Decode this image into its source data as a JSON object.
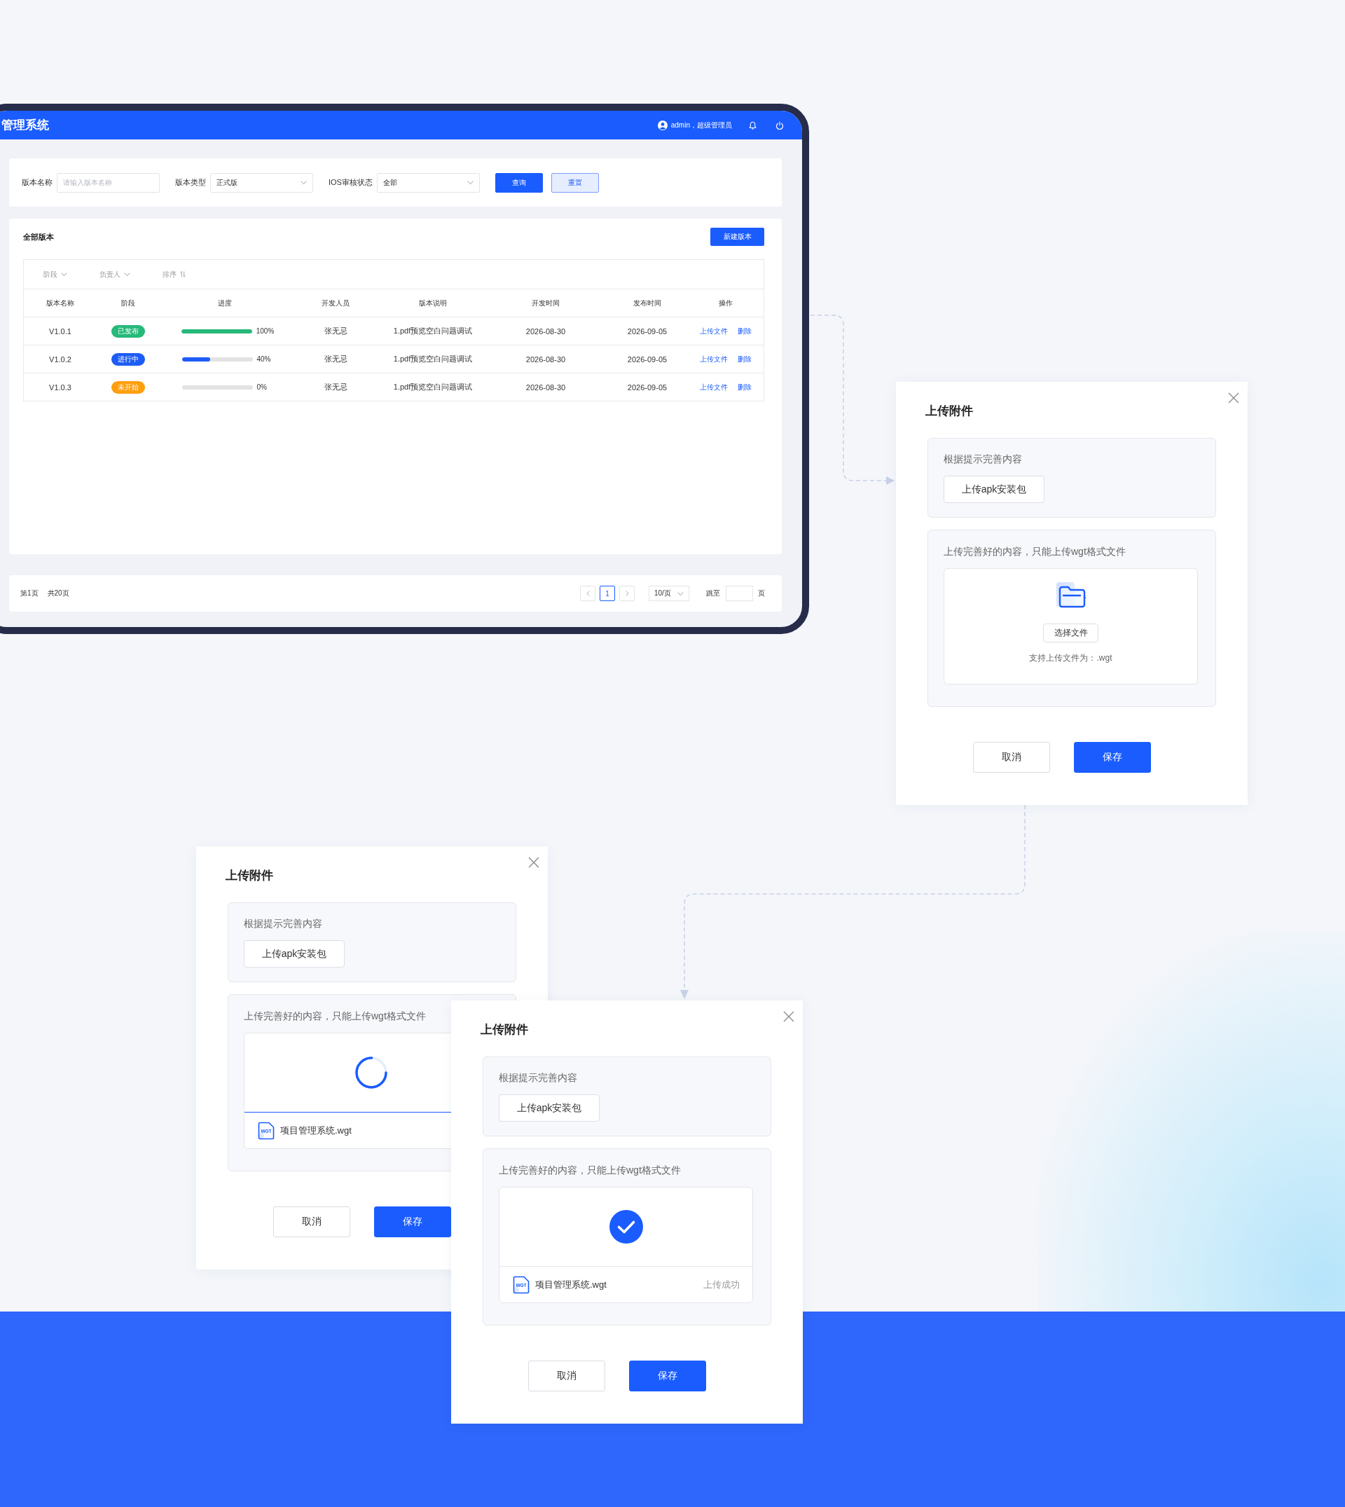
{
  "app": {
    "title": "管理系统",
    "user": "admin，超级管理员",
    "filters": [
      {
        "label": "版本名称",
        "kind": "input",
        "placeholder": "请输入版本名称"
      },
      {
        "label": "版本类型",
        "kind": "select",
        "value": "正式版"
      },
      {
        "label": "IOS审核状态",
        "kind": "select",
        "value": "全部"
      }
    ],
    "filter_buttons": [
      {
        "label": "查询",
        "kind": "primary"
      },
      {
        "label": "重置",
        "kind": "secondary"
      }
    ],
    "list": {
      "title": "全部版本",
      "new_button": "新建版本",
      "toolbar": [
        {
          "label": "阶段",
          "kind": "dropdown"
        },
        {
          "label": "负责人",
          "kind": "dropdown"
        },
        {
          "label": "排序",
          "kind": "sort"
        }
      ],
      "columns": [
        "版本名称",
        "阶段",
        "进度",
        "开发人员",
        "版本说明",
        "开发时间",
        "发布时间",
        "操作"
      ],
      "rows": [
        {
          "version": "V1.0.1",
          "stage": {
            "label": "已发布",
            "color": "#27b97a"
          },
          "level": 1,
          "progress": "100%",
          "developer": "张无忌",
          "description": "1.pdf预览空白问题调试",
          "dev_date": "2026-08-30",
          "release_date": "2026-09-05",
          "actions": [
            "上传文件",
            "删除"
          ]
        },
        {
          "version": "V1.0.2",
          "stage": {
            "label": "进行中",
            "color": "#1d5cf6"
          },
          "level": 0.4,
          "progress": "40%",
          "developer": "张无忌",
          "description": "1.pdf预览空白问题调试",
          "dev_date": "2026-08-30",
          "release_date": "2026-09-05",
          "actions": [
            "上传文件",
            "删除"
          ]
        },
        {
          "version": "V1.0.3",
          "stage": {
            "label": "未开始",
            "color": "#ff9e0d"
          },
          "level": 0,
          "progress": "0%",
          "developer": "张无忌",
          "description": "1.pdf预览空白问题调试",
          "dev_date": "2026-08-30",
          "release_date": "2026-09-05",
          "actions": [
            "上传文件",
            "删除"
          ]
        }
      ]
    },
    "pagination": {
      "current": "第1页",
      "total": "共20页",
      "pages": [
        {
          "label": "1",
          "selected": true
        }
      ],
      "page_size": "10/页",
      "jump_label": "跳至",
      "jump_unit": "页"
    }
  },
  "dialogs": [
    {
      "title": "上传附件",
      "sections": [
        {
          "hint": "根据提示完善内容",
          "button": "上传apk安装包"
        },
        {
          "hint": "上传完善好的内容，只能上传wgt格式文件",
          "upload": {
            "kind": "picker",
            "button": "选择文件",
            "note": "支持上传文件为：.wgt"
          }
        }
      ],
      "buttons": [
        {
          "label": "取消",
          "kind": "default"
        },
        {
          "label": "保存",
          "kind": "primary"
        }
      ]
    },
    {
      "title": "上传附件",
      "sections": [
        {
          "hint": "根据提示完善内容",
          "button": "上传apk安装包"
        },
        {
          "hint": "上传完善好的内容，只能上传wgt格式文件",
          "upload": {
            "kind": "uploading",
            "icon_label": "WGT",
            "file": "项目管理系统.wgt"
          }
        }
      ],
      "buttons": [
        {
          "label": "取消",
          "kind": "default"
        },
        {
          "label": "保存",
          "kind": "primary"
        }
      ]
    },
    {
      "title": "上传附件",
      "sections": [
        {
          "hint": "根据提示完善内容",
          "button": "上传apk安装包"
        },
        {
          "hint": "上传完善好的内容，只能上传wgt格式文件",
          "upload": {
            "kind": "uploaded",
            "icon_label": "WGT",
            "file": "项目管理系统.wgt",
            "status": "上传成功"
          }
        }
      ],
      "buttons": [
        {
          "label": "取消",
          "kind": "default"
        },
        {
          "label": "保存",
          "kind": "primary"
        }
      ]
    }
  ]
}
